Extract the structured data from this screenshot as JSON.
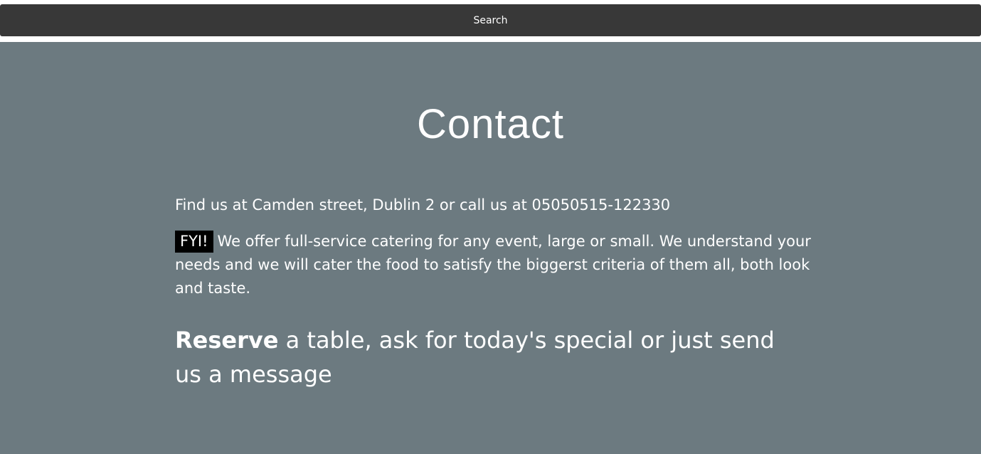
{
  "search_bar": {
    "label": "Search"
  },
  "contact": {
    "title": "Contact",
    "address_line": "Find us at Camden street, Dublin 2 or call us at 05050515-122330",
    "fyi_tag": "FYI!",
    "catering_text": "We offer full-service catering for any event, large or small. We understand your needs and we will cater the food to satisfy the biggerst criteria of them all, both look and taste.",
    "reserve_bold": "Reserve",
    "reserve_rest": " a table, ask for today's special or just send us a message"
  },
  "colors": {
    "search_bar_bg": "#383838",
    "section_bg": "#6c7a80",
    "text": "#ffffff",
    "fyi_bg": "#000000"
  }
}
